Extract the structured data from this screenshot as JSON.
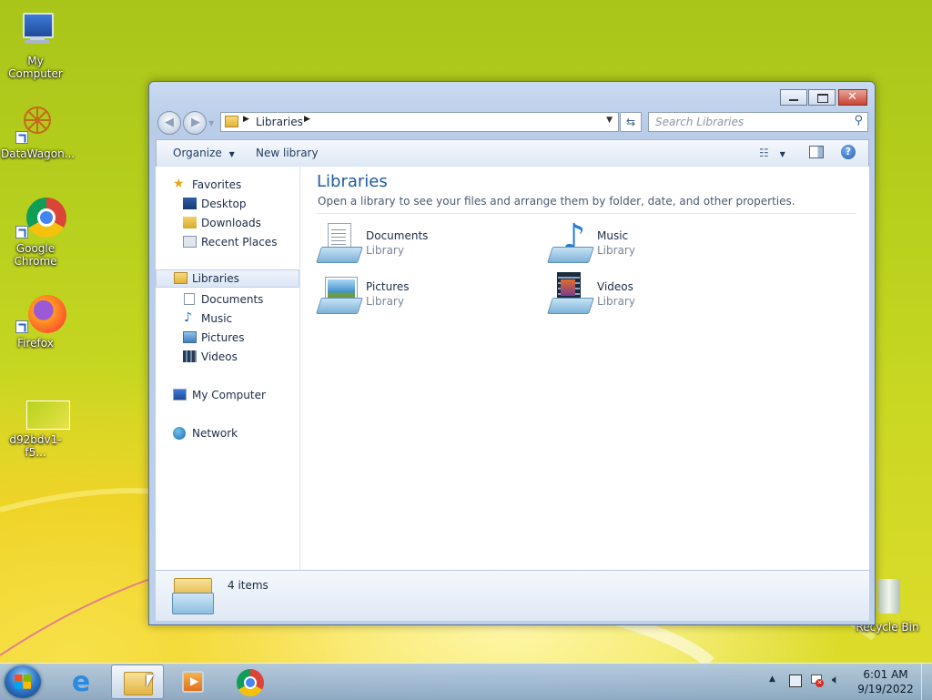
{
  "desktop": {
    "icons": [
      {
        "label": "My Computer"
      },
      {
        "label": "DataWagon..."
      },
      {
        "label": "Google Chrome"
      },
      {
        "label": "Firefox"
      },
      {
        "label": "d92bdv1-f5..."
      },
      {
        "label": "Recycle Bin"
      }
    ]
  },
  "window": {
    "address": {
      "crumb": "Libraries"
    },
    "search": {
      "placeholder": "Search Libraries"
    },
    "toolbar": {
      "organize": "Organize",
      "new_library": "New library"
    },
    "nav": {
      "favorites": {
        "label": "Favorites",
        "items": [
          "Desktop",
          "Downloads",
          "Recent Places"
        ]
      },
      "libraries": {
        "label": "Libraries",
        "items": [
          "Documents",
          "Music",
          "Pictures",
          "Videos"
        ]
      },
      "computer": "My Computer",
      "network": "Network"
    },
    "content": {
      "title": "Libraries",
      "subtitle": "Open a library to see your files and arrange them by folder, date, and other properties.",
      "libraries": [
        {
          "name": "Documents",
          "type": "Library"
        },
        {
          "name": "Music",
          "type": "Library"
        },
        {
          "name": "Pictures",
          "type": "Library"
        },
        {
          "name": "Videos",
          "type": "Library"
        }
      ]
    },
    "details": {
      "count": "4 items"
    }
  },
  "taskbar": {
    "clock": {
      "time": "6:01 AM",
      "date": "9/19/2022"
    }
  },
  "colors": {
    "accent": "#3a6ea5",
    "title_blue": "#1e5a9c"
  }
}
